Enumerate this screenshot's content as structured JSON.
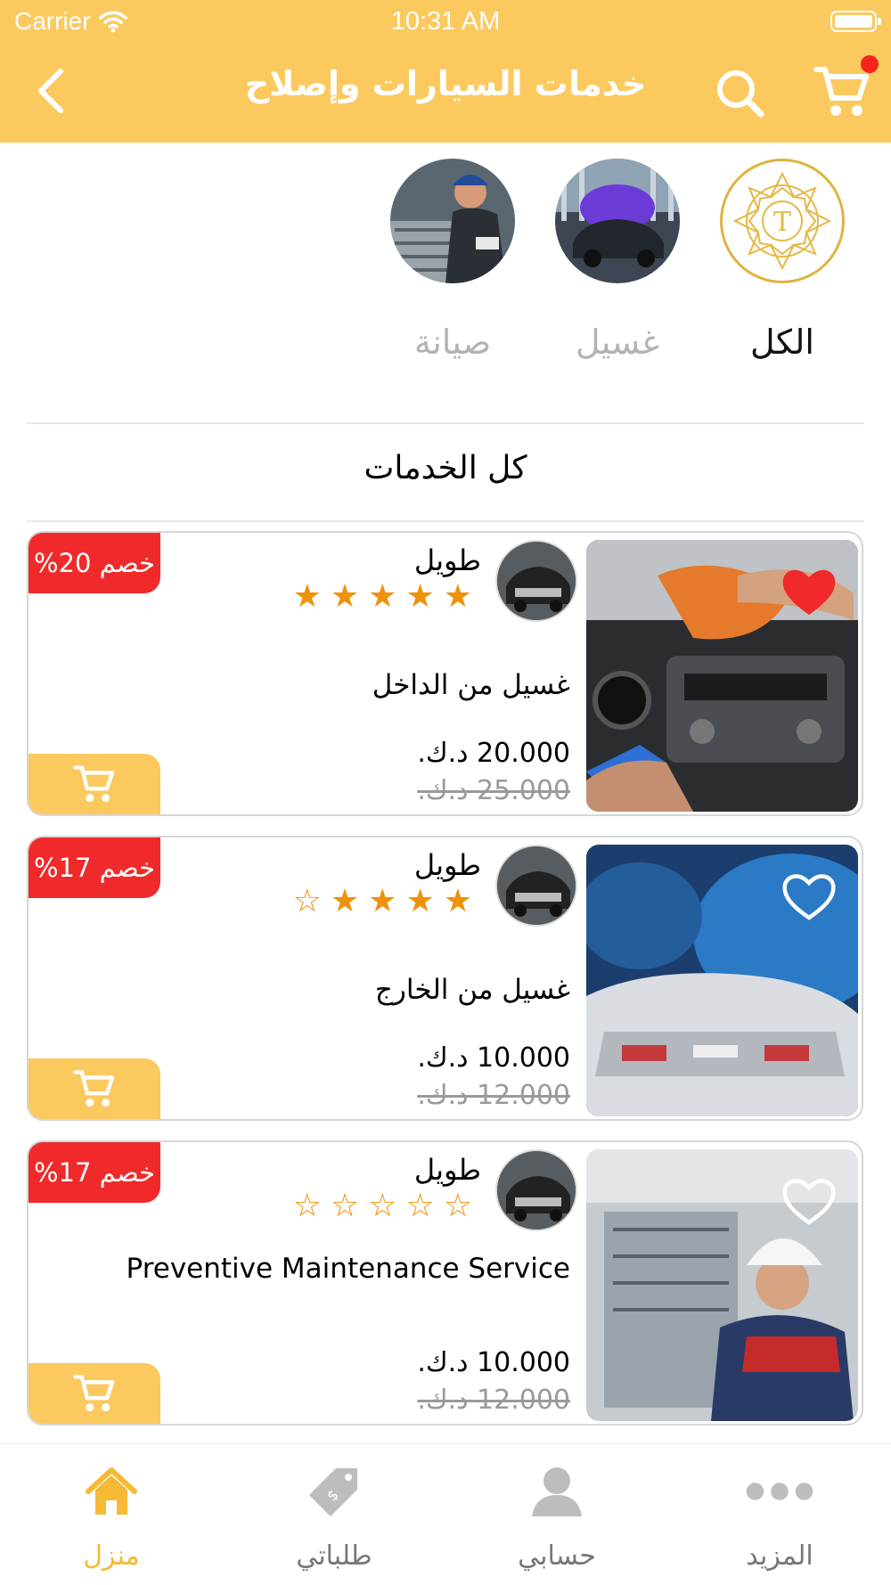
{
  "status_bar": {
    "carrier": "Carrier",
    "time": "10:31 AM"
  },
  "header": {
    "title": "خدمات السيارات وإصلاح"
  },
  "categories": {
    "tabs": [
      {
        "label": "الكل",
        "active": true
      },
      {
        "label": "غسيل",
        "active": false
      },
      {
        "label": "صيانة",
        "active": false
      }
    ]
  },
  "section_title": "كل الخدمات",
  "products": [
    {
      "vendor": "طويل",
      "rating": 5,
      "name": "غسيل من الداخل",
      "price": "20.000 د.ك.",
      "old_price": "25.000 د.ك.",
      "discount": "خصم 20%",
      "favorite": true
    },
    {
      "vendor": "طويل",
      "rating": 4,
      "name": "غسيل من الخارج",
      "price": "10.000 د.ك.",
      "old_price": "12.000 د.ك.",
      "discount": "خصم 17%",
      "favorite": false
    },
    {
      "vendor": "طويل",
      "rating": 0,
      "name": "Preventive Maintenance Service",
      "price": "10.000 د.ك.",
      "old_price": "12.000 د.ك.",
      "discount": "خصم 17%",
      "favorite": false
    }
  ],
  "tabbar": {
    "items": [
      {
        "label": "منزل",
        "icon": "home-icon",
        "active": true
      },
      {
        "label": "طلباتي",
        "icon": "price-tag-icon",
        "active": false
      },
      {
        "label": "حسابي",
        "icon": "user-icon",
        "active": false
      },
      {
        "label": "المزيد",
        "icon": "more-icon",
        "active": false
      }
    ]
  },
  "colors": {
    "accent": "#fbc95e",
    "badge": "#f02a2a",
    "star": "#f0910a",
    "active_tab": "#f5b935"
  }
}
